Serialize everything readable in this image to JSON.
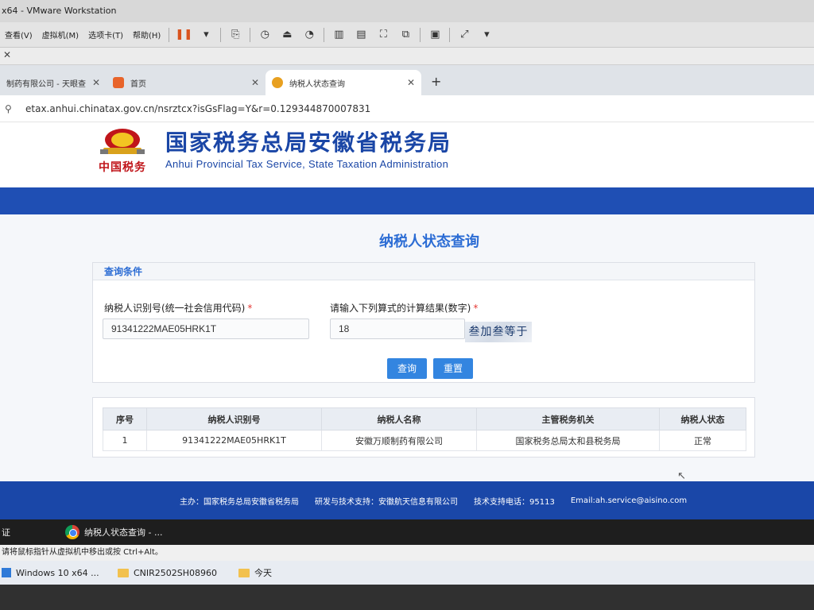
{
  "vmware": {
    "title": "x64 - VMware Workstation",
    "menu": [
      "查看(V)",
      "虚拟机(M)",
      "选项卡(T)",
      "帮助(H)"
    ]
  },
  "browser": {
    "tabs": [
      {
        "label": "制药有限公司 - 天眼查"
      },
      {
        "label": "首页"
      },
      {
        "label": "纳税人状态查询"
      }
    ],
    "url": "etax.anhui.chinatax.gov.cn/nsrztcx?isGsFlag=Y&r=0.129344870007831"
  },
  "site": {
    "seal": "中国税务",
    "title_cn": "国家税务总局安徽省税务局",
    "title_en": "Anhui Provincial Tax Service, State Taxation Administration"
  },
  "page": {
    "title": "纳税人状态查询",
    "panel_head": "查询条件",
    "id_label": "纳税人识别号(统一社会信用代码)",
    "id_value": "91341222MAE05HRK1T",
    "captcha_label": "请输入下列算式的计算结果(数字)",
    "captcha_value": "18",
    "captcha_image": "叁加叁等于",
    "required_mark": "*",
    "query_button": "查询",
    "reset_button": "重置"
  },
  "results": {
    "headers": [
      "序号",
      "纳税人识别号",
      "纳税人名称",
      "主管税务机关",
      "纳税人状态"
    ],
    "rows": [
      [
        "1",
        "91341222MAE05HRK1T",
        "安徽万顺制药有限公司",
        "国家税务总局太和县税务局",
        "正常"
      ]
    ]
  },
  "footer": {
    "host": "主办：国家税务总局安徽省税务局",
    "support": "研发与技术支持：安徽航天信息有限公司",
    "phone": "技术支持电话：95113",
    "email": "Email:ah.service@aisino.com"
  },
  "guest_taskbar": {
    "left_text": "证",
    "chrome_item": "纳税人状态查询 - ..."
  },
  "hint": "请将鼠标指针从虚拟机中移出或按 Ctrl+Alt。",
  "host_taskbar": {
    "items": [
      "Windows 10 x64 ...",
      "CNIR2502SH08960",
      "今天"
    ]
  }
}
